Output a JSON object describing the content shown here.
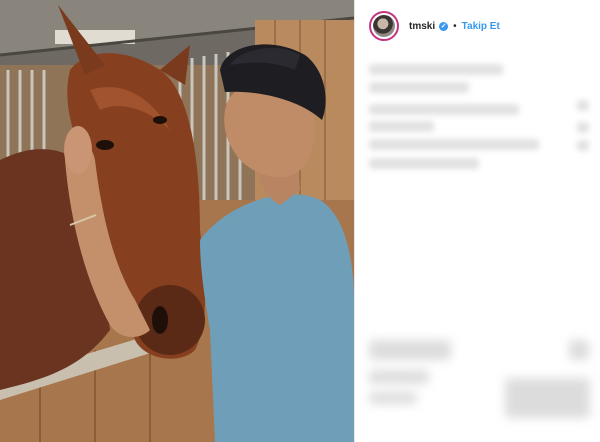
{
  "post": {
    "username": "tmski",
    "verified_icon": "check-icon",
    "separator": "•",
    "follow_label": "Takip Et",
    "accent_color": "#3897f0"
  }
}
